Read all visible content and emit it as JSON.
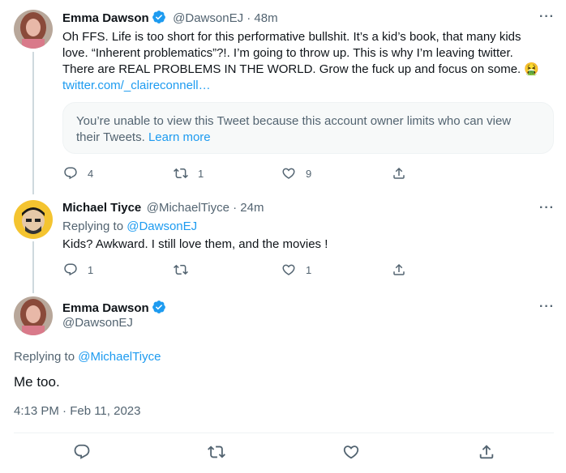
{
  "tweets": [
    {
      "name": "Emma Dawson",
      "handle": "@DawsonEJ · 48m",
      "text_line1": "Oh FFS. Life is too short for this performative bullshit. It’s a kid’s book, that many kids",
      "text_line2": "love. “Inherent problematics”?!. I’m going to throw up. This is why I’m leaving twitter.",
      "text_line3": "There are REAL PROBLEMS IN THE WORLD. Grow the fuck up and focus on some. 🤮",
      "link": "twitter.com/_claireconnell…",
      "quote_text": "You’re unable to view this Tweet because this account owner limits who can view",
      "quote_text2": "their Tweets.",
      "quote_link": "Learn more",
      "replies": "4",
      "retweets": "1",
      "likes": "9"
    },
    {
      "name": "Michael Tiyce",
      "handle": "@MichaelTiyce · 24m",
      "replying_prefix": "Replying to ",
      "replying_to": "@DawsonEJ",
      "text": "Kids? Awkward.  I still love them, and the movies !",
      "replies": "1",
      "retweets": "",
      "likes": "1"
    }
  ],
  "main_tweet": {
    "name": "Emma Dawson",
    "handle": "@DawsonEJ",
    "replying_prefix": "Replying to ",
    "replying_to": "@MichaelTiyce",
    "text": "Me too.",
    "timestamp": "4:13 PM · Feb 11, 2023"
  },
  "more_glyph": "···",
  "colors": {
    "accent": "#1d9bf0",
    "muted": "#536471",
    "line": "#cfd9de"
  },
  "icons": [
    "verified-badge-icon",
    "more-icon",
    "reply-icon",
    "retweet-icon",
    "like-icon",
    "share-icon"
  ]
}
